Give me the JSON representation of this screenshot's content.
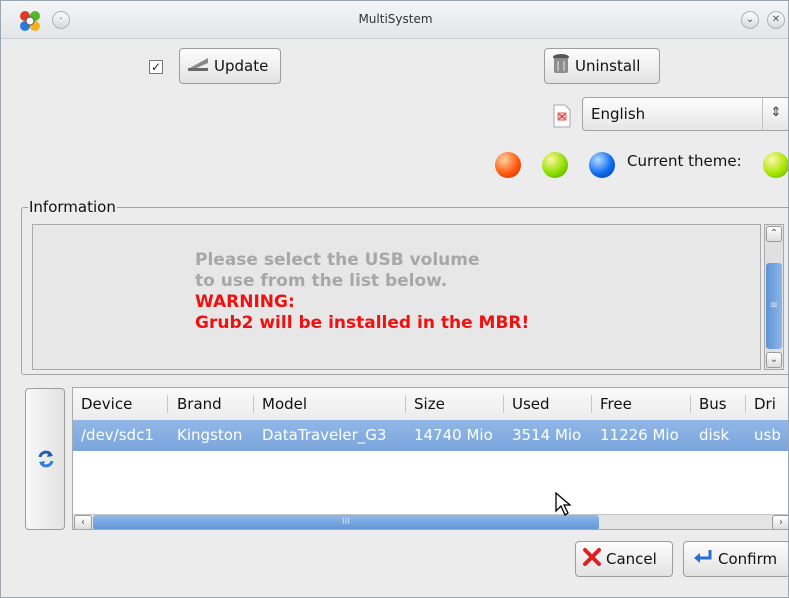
{
  "window": {
    "title": "MultiSystem"
  },
  "toolbar": {
    "update_checked": true,
    "update_label": "Update",
    "uninstall_label": "Uninstall"
  },
  "language": {
    "selected": "English"
  },
  "theme": {
    "label": "Current theme:",
    "options": [
      {
        "name": "red-orange",
        "color": "#ff5a10"
      },
      {
        "name": "green",
        "color": "#8fe000"
      },
      {
        "name": "blue",
        "color": "#0f6cf0"
      }
    ],
    "current_color": "#a8e600"
  },
  "information": {
    "legend": "Information",
    "line1": "Please select the USB volume",
    "line2": "to use from the list below.",
    "warning_title": "WARNING:",
    "warning_text": "Grub2 will be installed in the MBR!"
  },
  "device_table": {
    "columns": [
      "Device",
      "Brand",
      "Model",
      "Size",
      "Used",
      "Free",
      "Bus",
      "Dri"
    ],
    "rows": [
      [
        "/dev/sdc1",
        "Kingston",
        "DataTraveler_G3",
        "14740 Mio",
        "3514 Mio",
        "11226 Mio",
        "disk",
        "usb"
      ]
    ],
    "scroll_thumb_label": "III"
  },
  "footer": {
    "cancel_label": "Cancel",
    "confirm_label": "Confirm"
  }
}
